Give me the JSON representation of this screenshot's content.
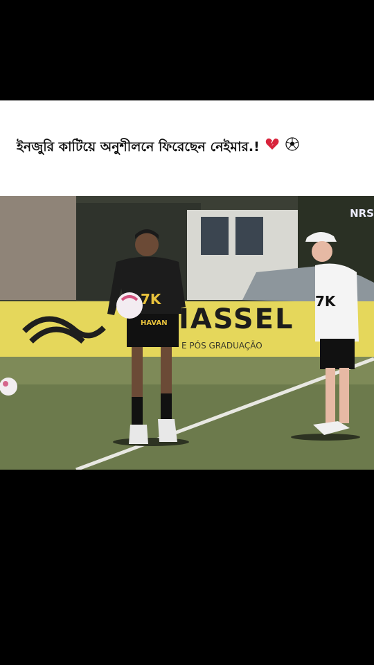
{
  "caption": {
    "text": "ইনজুরি কাটিয়ে অনুশীলনে ফিরেছেন নেইমার.!",
    "emojis": [
      "broken-heart-icon",
      "soccer-ball-icon"
    ]
  },
  "photo": {
    "watermark": "NRS",
    "banner": {
      "text": "IASSEL",
      "subtext": "E PÓS GRADUAÇÃO"
    },
    "player_jersey": {
      "sponsor": "7K",
      "sleeve": "HAVAN"
    },
    "coach_jersey": {
      "sponsor": "7K"
    }
  }
}
